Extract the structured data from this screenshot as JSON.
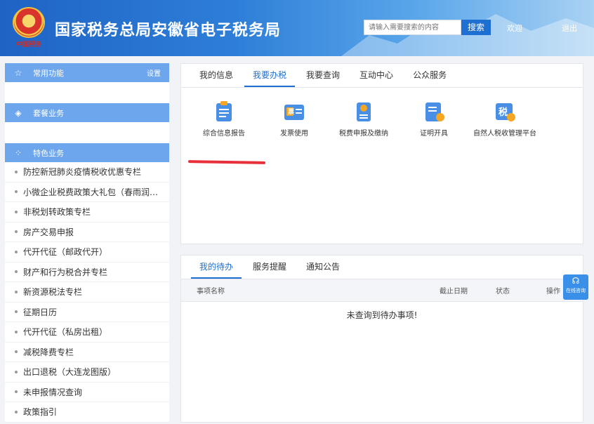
{
  "header": {
    "site_title": "国家税务总局安徽省电子税务局",
    "logo_signature": "中国税务",
    "search_placeholder": "请输入需要搜索的内容",
    "search_button": "搜索",
    "welcome": "欢迎",
    "logout": "退出"
  },
  "sidebar": {
    "common": {
      "title": "常用功能",
      "action": "设置",
      "icon": "star-icon"
    },
    "package": {
      "title": "套餐业务",
      "icon": "layers-icon"
    },
    "special": {
      "title": "特色业务",
      "icon": "grid-icon",
      "items": [
        "防控新冠肺炎疫情税收优惠专栏",
        "小微企业税费政策大礼包（春雨润苗）",
        "非税划转政策专栏",
        "房产交易申报",
        "代开代征（邮政代开）",
        "财产和行为税合并专栏",
        "新资源税法专栏",
        "征期日历",
        "代开代征（私房出租）",
        "减税降费专栏",
        "出口退税（大连龙图版）",
        "未申报情况查询",
        "政策指引"
      ]
    }
  },
  "main_tabs": [
    "我的信息",
    "我要办税",
    "我要查询",
    "互动中心",
    "公众服务"
  ],
  "main_active_tab": 1,
  "services": [
    {
      "label": "综合信息报告",
      "icon": "clipboard-icon"
    },
    {
      "label": "发票使用",
      "icon": "invoice-icon",
      "glyph": "票"
    },
    {
      "label": "税费申报及缴纳",
      "icon": "tax-declare-icon"
    },
    {
      "label": "证明开具",
      "icon": "certificate-icon"
    },
    {
      "label": "自然人税收管理平台",
      "icon": "personal-tax-icon",
      "glyph": "税"
    }
  ],
  "todo_tabs": [
    "我的待办",
    "服务提醒",
    "通知公告"
  ],
  "todo_active_tab": 0,
  "todo_table": {
    "columns": [
      "事项名称",
      "截止日期",
      "状态",
      "操作"
    ],
    "empty_message": "未查询到待办事项!"
  },
  "consult": {
    "label": "在线咨询",
    "icon": "headset-icon"
  },
  "colors": {
    "primary": "#1e6fd2",
    "sidebar_head": "#6ea6ee",
    "highlight_red": "#e8303a"
  }
}
